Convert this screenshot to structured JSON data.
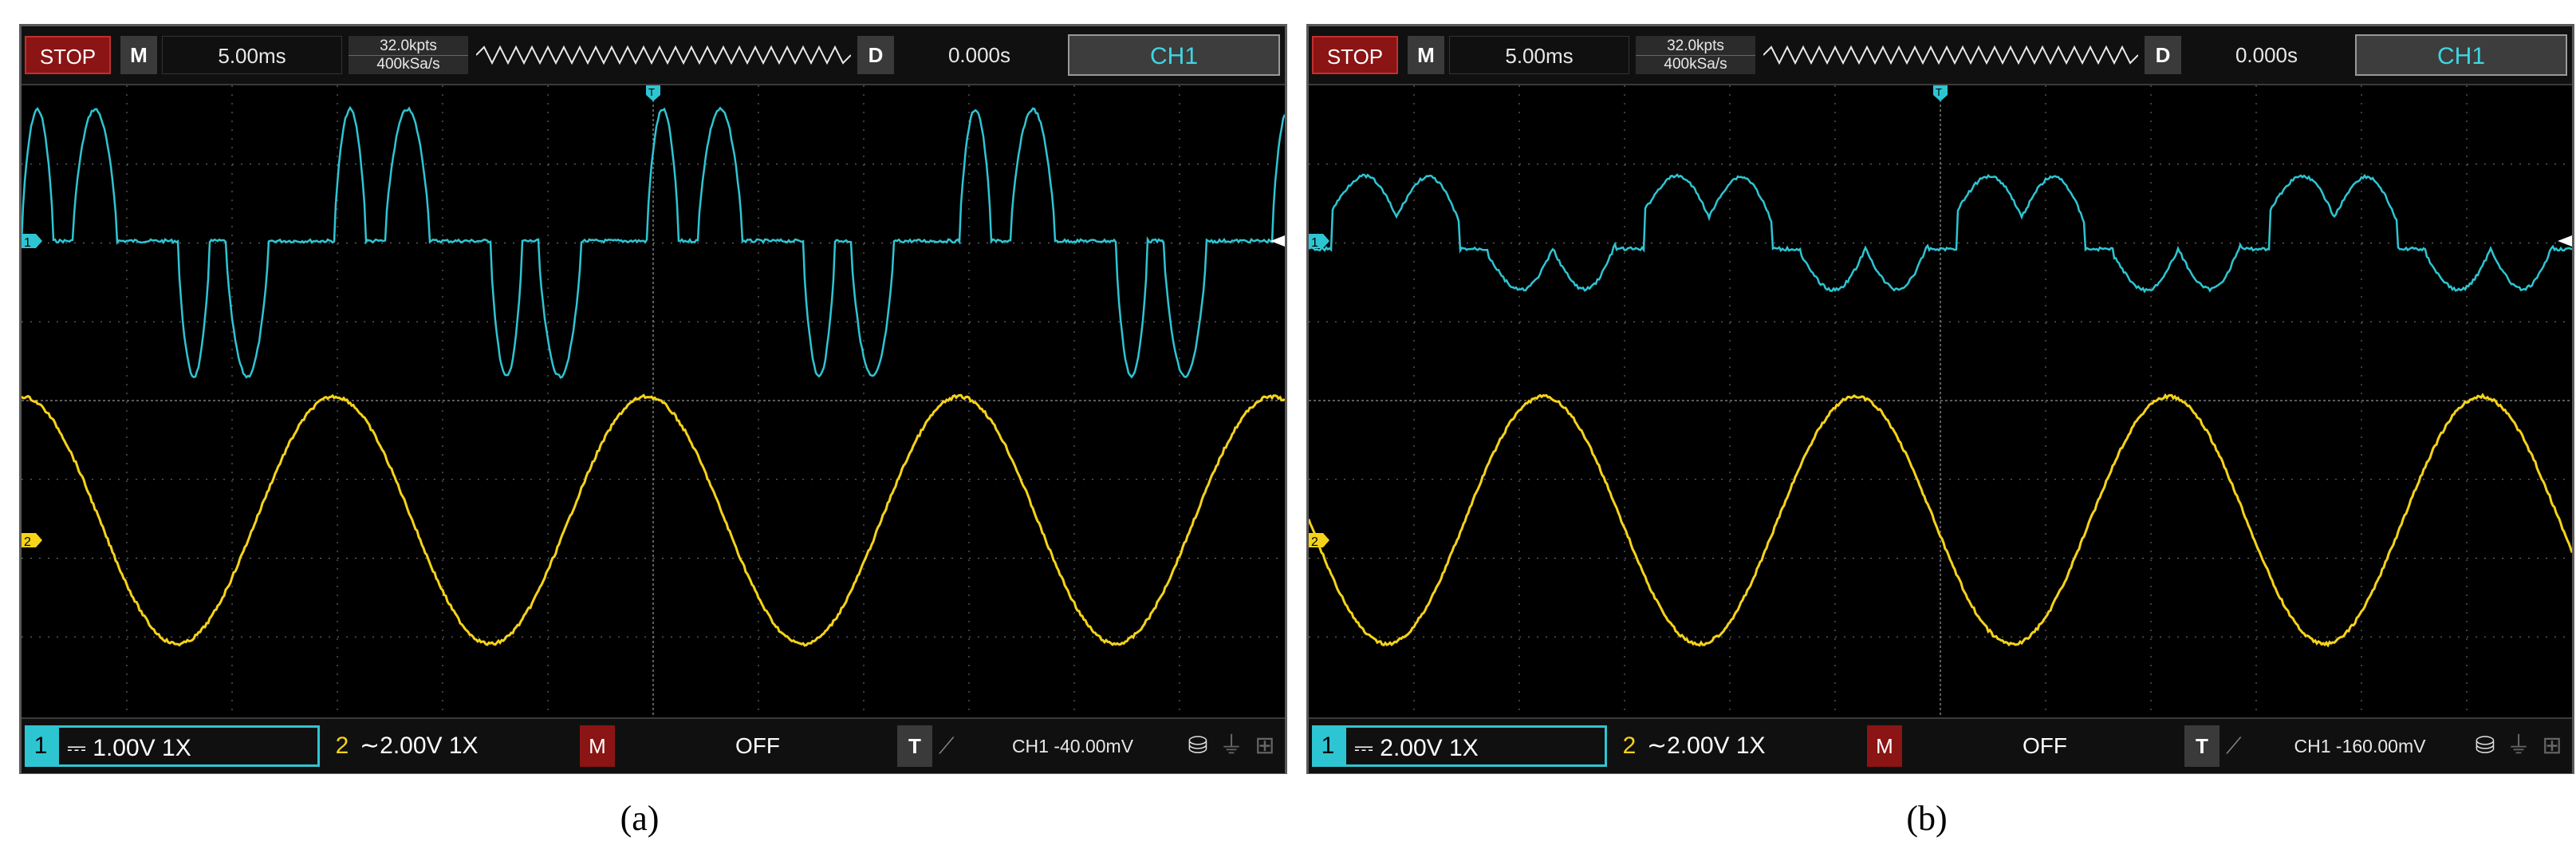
{
  "panels": [
    {
      "run_state": "STOP",
      "mode_label": "M",
      "timebase": "5.00ms",
      "memory_depth": "32.0kpts",
      "sample_rate": "400kSa/s",
      "delay_label": "D",
      "delay_value": "0.000s",
      "channel_select": "CH1",
      "ch1_number": "1",
      "ch1_scale": "1.00V 1X",
      "ch2_number": "2",
      "ch2_scale": "2.00V 1X",
      "math_label": "M",
      "math_value": "OFF",
      "trigger_label": "T",
      "trigger_level": "CH1 -40.00mV",
      "caption": "(a)",
      "ch1_marker": "1",
      "ch2_marker": "2",
      "trigger_marker": "T"
    },
    {
      "run_state": "STOP",
      "mode_label": "M",
      "timebase": "5.00ms",
      "memory_depth": "32.0kpts",
      "sample_rate": "400kSa/s",
      "delay_label": "D",
      "delay_value": "0.000s",
      "channel_select": "CH1",
      "ch1_number": "1",
      "ch1_scale": "2.00V 1X",
      "ch2_number": "2",
      "ch2_scale": "2.00V 1X",
      "math_label": "M",
      "math_value": "OFF",
      "trigger_label": "T",
      "trigger_level": "CH1 -160.00mV",
      "caption": "(b)",
      "ch1_marker": "1",
      "ch2_marker": "2",
      "trigger_marker": "T"
    }
  ],
  "colors": {
    "ch1": "#2ec5d2",
    "ch2": "#f5d31a",
    "grid": "#7a7a7a",
    "stop": "#8b1414"
  },
  "icons": [
    "usb-drive-icon",
    "usb-icon",
    "network-icon",
    "trigger-edge-icon"
  ]
}
